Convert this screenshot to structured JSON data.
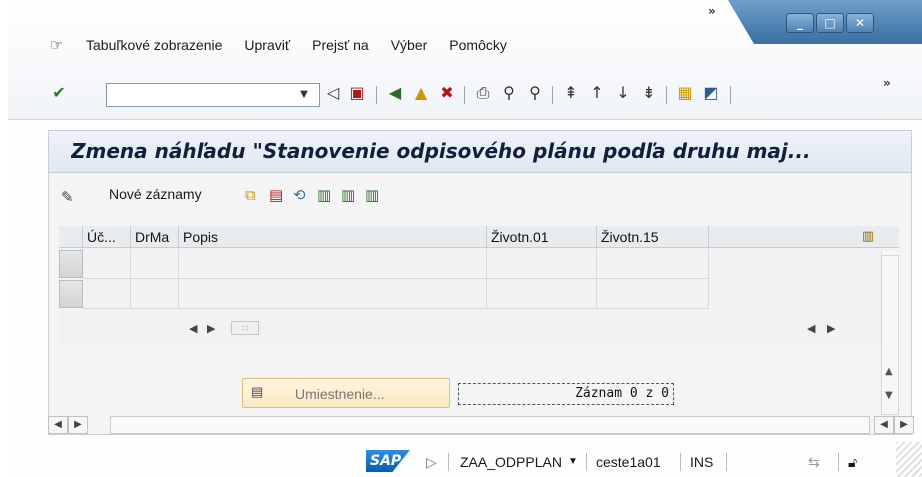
{
  "menubar": {
    "items": [
      {
        "label": "Tabuľkové zobrazenie"
      },
      {
        "label": "Upraviť"
      },
      {
        "label": "Prejsť na"
      },
      {
        "label": "Výber"
      },
      {
        "label": "Pomôcky"
      }
    ],
    "overflow": "»"
  },
  "toolbar": {
    "command_value": "",
    "overflow": "»"
  },
  "screen": {
    "title": "Zmena náhľadu \"Stanovenie odpisového plánu podľa druhu maj...",
    "new_entries_label": "Nové záznamy"
  },
  "table": {
    "columns": [
      {
        "label": "Úč..."
      },
      {
        "label": "DrMa"
      },
      {
        "label": "Popis"
      },
      {
        "label": "Životn.01"
      },
      {
        "label": "Životn.15"
      }
    ],
    "rows": [
      [
        "",
        "",
        "",
        "",
        ""
      ],
      [
        "",
        "",
        "",
        "",
        ""
      ]
    ]
  },
  "footer": {
    "position_button": "Umiestnenie...",
    "record_count": "Záznam 0 z 0"
  },
  "statusbar": {
    "logo": "SAP",
    "transaction": "ZAA_ODPPLAN",
    "server": "ceste1a01",
    "mode": "INS"
  }
}
